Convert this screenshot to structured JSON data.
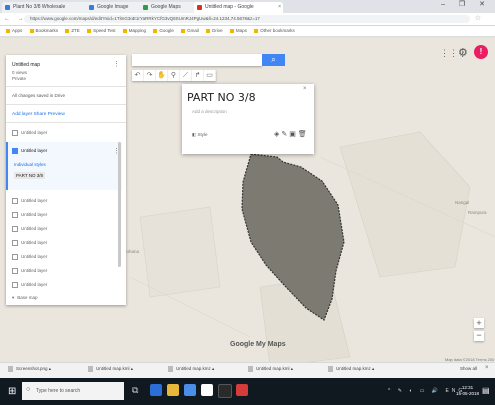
{
  "browser": {
    "tabs": [
      {
        "label": "Plant No 3/8 Wholesale"
      },
      {
        "label": "Google Image"
      },
      {
        "label": "Google Maps"
      },
      {
        "label": "Untitled map - Google"
      }
    ],
    "url": "https://www.google.com/maps/d/edit?mid=1TlmG3oE1rYaRRkYCfG3vQ8SUmRJ4PgUw&ll=24.1234,74.5678&z=17",
    "bookmarks": [
      "Apps",
      "Bookmarks",
      "ZTE",
      "Speed Test",
      "Mapping",
      "Google",
      "Gmail",
      "Drive",
      "Maps",
      "Other bookmarks"
    ]
  },
  "panel": {
    "title": "Untitled map",
    "meta1": "0 views",
    "meta2": "Private",
    "count": "All changes saved in Drive",
    "actions": "Add layer   Share   Preview",
    "layers": [
      "Untitled layer",
      "Untitled layer",
      "Untitled layer",
      "Untitled layer",
      "Untitled layer",
      "Untitled layer",
      "Untitled layer",
      "Untitled layer",
      "Base map"
    ],
    "active_layer": {
      "name": "Untitled layer",
      "style_link": "Individual styles",
      "feature": "PART NO 3/8"
    }
  },
  "card": {
    "title": "PART NO 3/8",
    "description": "Add a description",
    "style": "Style"
  },
  "map": {
    "labels": [
      "Rampura",
      "Gohana",
      "Nangal"
    ],
    "polygon_fill": "#7d7a72",
    "polygon_stroke": "#333333",
    "logo": "Google My Maps",
    "terms": "Map data ©2018  Terms  200 m"
  },
  "downloads": {
    "items": [
      "Screenshot.png",
      "Untitled map.kml",
      "Untitled map.kmz",
      "Untitled map.kml",
      "Untitled map.kmz"
    ],
    "show_all": "Show all"
  },
  "taskbar": {
    "search_placeholder": "Type here to search",
    "time": "12:31",
    "date": "15-05-2018"
  }
}
